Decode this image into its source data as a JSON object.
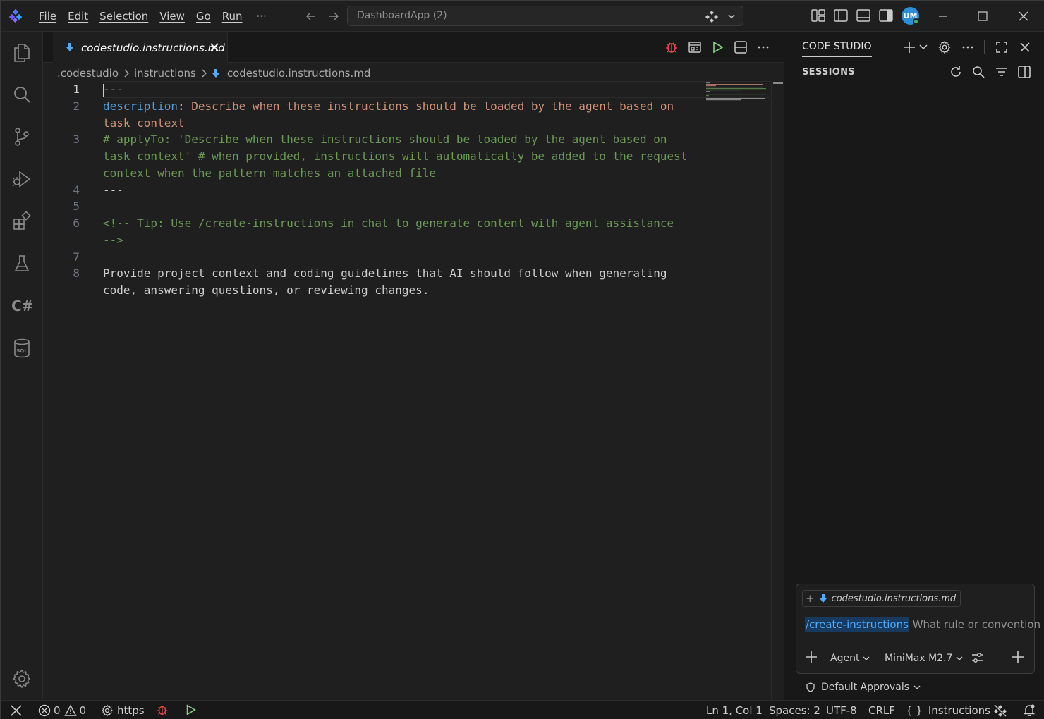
{
  "titlebar": {
    "menu": [
      "File",
      "Edit",
      "Selection",
      "View",
      "Go",
      "Run"
    ],
    "more": "···",
    "command_center": "DashboardApp (2)",
    "avatar_initials": "UM"
  },
  "tab": {
    "label": "codestudio.instructions.md"
  },
  "breadcrumb": {
    "items": [
      ".codestudio",
      "instructions",
      "codestudio.instructions.md"
    ]
  },
  "editor": {
    "lines": [
      {
        "num": "1",
        "text": "---"
      },
      {
        "num": "2",
        "key": "description",
        "sep": ": ",
        "value": "Describe when these instructions should be loaded by the agent based on",
        "cont": "task context"
      },
      {
        "num": "3",
        "text": "# applyTo: 'Describe when these instructions should be loaded by the agent based on",
        "cont1": "task context' # when provided, instructions will automatically be added to the request",
        "cont2": "context when the pattern matches an attached file"
      },
      {
        "num": "4",
        "text": "---"
      },
      {
        "num": "5",
        "text": ""
      },
      {
        "num": "6",
        "text": "<!-- Tip: Use /create-instructions in chat to generate content with agent assistance",
        "cont": "-->"
      },
      {
        "num": "7",
        "text": ""
      },
      {
        "num": "8",
        "text": "Provide project context and coding guidelines that AI should follow when generating",
        "cont": "code, answering questions, or reviewing changes."
      }
    ]
  },
  "panel": {
    "title": "CODE STUDIO",
    "sessions_title": "SESSIONS",
    "chat": {
      "context_file": "codestudio.instructions.md",
      "slash_command": "/create-instructions",
      "placeholder": "What rule or convention",
      "mode": "Agent",
      "model": "MiniMax M2.7"
    },
    "approvals": "Default Approvals"
  },
  "statusbar": {
    "errors": "0",
    "warnings": "0",
    "remote": "https",
    "position": "Ln 1, Col 1",
    "spaces": "Spaces: 2",
    "encoding": "UTF-8",
    "eol": "CRLF",
    "language": "Instructions",
    "language_glyph": "{ }"
  },
  "colors": {
    "accent": "#0078d4",
    "keyword": "#569cd6",
    "string": "#ce9178",
    "comment": "#6a9955",
    "debug_red": "#f14c4c",
    "run_green": "#89d185"
  }
}
